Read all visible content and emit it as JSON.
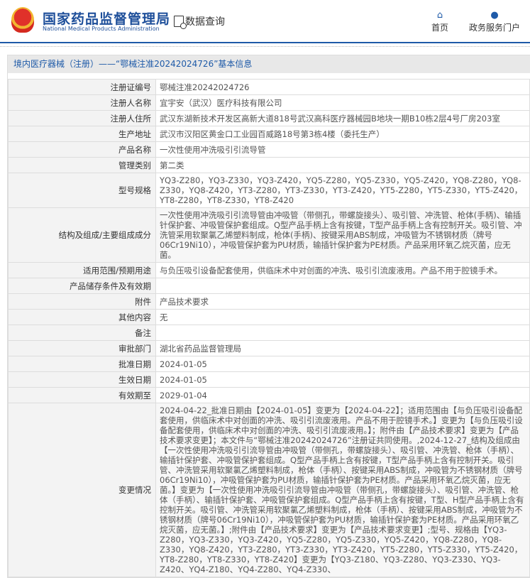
{
  "header": {
    "org_cn": "国家药品监督管理局",
    "org_en": "National Medical Products Administration",
    "query": "数据查询",
    "nav": [
      {
        "label": "首页",
        "icon": "home-icon"
      },
      {
        "label": "政务服务门户",
        "icon": "user-icon"
      }
    ]
  },
  "title": "境内医疗器械（注册）——“鄂械注准20242024726”基本信息",
  "rows": [
    {
      "label": "注册证编号",
      "value": "鄂械注准20242024726"
    },
    {
      "label": "注册人名称",
      "value": "宜宇安（武汉）医疗科技有限公司"
    },
    {
      "label": "注册人住所",
      "value": "武汉东湖新技术开发区高新大道818号武汉高科医疗器械园B地块一期B10栋2层4号厂房203室"
    },
    {
      "label": "生产地址",
      "value": "武汉市汉阳区黄金口工业园百威路18号第3栋4楼（委托生产）"
    },
    {
      "label": "产品名称",
      "value": "一次性使用冲洗吸引引流导管"
    },
    {
      "label": "管理类别",
      "value": "第二类"
    },
    {
      "label": "型号规格",
      "value": "YQ3-Z280，YQ3-Z330，YQ3-Z420，YQ5-Z280，YQ5-Z330，YQ5-Z420，YQ8-Z280，YQ8-Z330，YQ8-Z420，YT3-Z280，YT3-Z330，YT3-Z420，YT5-Z280，YT5-Z330，YT5-Z420，YT8-Z280，YT8-Z330，YT8-Z420"
    },
    {
      "label": "结构及组成/主要组成成分",
      "value": "一次性使用冲洗吸引引流导管由冲吸管（带侧孔，带螺旋接头）、吸引管、冲洗管、枪体(手柄)、输插针保护套、冲吸管保护套组成。Q型产品手柄上含有按键，T型产品手柄上含有控制开关。吸引管、冲洗管采用软聚氯乙烯塑料制成，枪体(手柄)、按键采用ABS制成，冲吸管为不锈钢材质（牌号06Cr19Ni10），冲吸管保护套为PU材质，输插针保护套为PE材质。产品采用环氧乙烷灭菌，应无菌。"
    },
    {
      "label": "适用范围/预期用途",
      "value": "与负压吸引设备配套使用，供临床术中对创面的冲洗、吸引引流废液用。产品不用于腔镜手术。"
    },
    {
      "label": "产品储存条件及有效期",
      "value": ""
    },
    {
      "label": "附件",
      "value": "产品技术要求"
    },
    {
      "label": "其他内容",
      "value": "无"
    },
    {
      "label": "备注",
      "value": ""
    },
    {
      "label": "审批部门",
      "value": "湖北省药品监督管理局"
    },
    {
      "label": "批准日期",
      "value": "2024-01-05"
    },
    {
      "label": "生效日期",
      "value": "2024-01-05"
    },
    {
      "label": "有效期至",
      "value": "2029-01-04"
    },
    {
      "label": "变更情况",
      "value": "2024-04-22_批准日期由【2024-01-05】变更为【2024-04-22】；适用范围由【与负压吸引设备配套使用，供临床术中对创面的冲洗、吸引引流废液用。产品不用于腔镜手术。】变更为【与负压吸引设备配套使用，供临床术中对创面的冲洗、吸引引流废液用。】；附件由【产品技术要求】变更为【产品技术要求变更】；本文件与“鄂械注准20242024726”注册证共同使用。,2024-12-27_结构及组成由【一次性使用冲洗吸引引流导管由冲吸管（带侧孔，带螺旋接头）、吸引管、冲洗管、枪体（手柄）、输插针保护套、冲吸管保护套组成。Q型产品手柄上含有按键，T型产品手柄上含有控制开关。吸引管、冲洗管采用软聚氯乙烯塑料制成，枪体（手柄）、按键采用ABS制成，冲吸管为不锈钢材质（牌号06Cr19Ni10），冲吸管保护套为PU材质，输插针保护套为PE材质。产品采用环氧乙烷灭菌，应无菌。】变更为【一次性使用冲洗吸引引流导管由冲吸管（带侧孔，带螺旋接头）、吸引管、冲洗管、枪体（手柄）、输插针保护套、冲吸管保护套组成。Q型产品手柄上含有按键，T型、H型产品手柄上含有控制开关。吸引管、冲洗管采用软聚氯乙烯塑料制成，枪体（手柄）、按键采用ABS制成，冲吸管为不锈钢材质（牌号06Cr19Ni10），冲吸管保护套为PU材质，输插针保护套为PE材质。产品采用环氧乙烷灭菌，应无菌。】;附件由【产品技术要求】变更为【产品技术要求变更】;型号、规格由【YQ3-Z280，YQ3-Z330，YQ3-Z420，YQ5-Z280，YQ5-Z330，YQ5-Z420，YQ8-Z280，YQ8-Z330，YQ8-Z420，YT3-Z280，YT3-Z330，YT3-Z420，YT5-Z280，YT5-Z330，YT5-Z420，YT8-Z280，YT8-Z330，YT8-Z420】变更为【YQ3-Z180、YQ3-Z280、YQ3-Z330、YQ3-Z420、YQ4-Z180、YQ4-Z280、YQ4-Z330、"
    }
  ]
}
